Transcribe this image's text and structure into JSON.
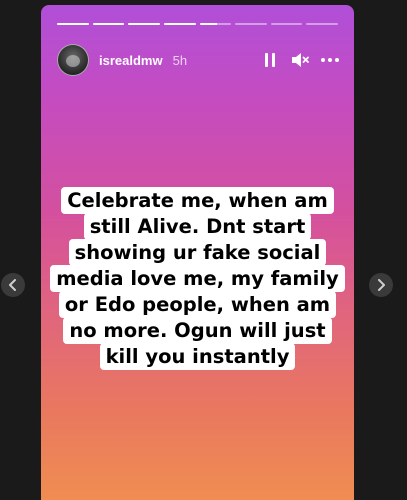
{
  "story": {
    "username": "isrealdmw",
    "time_ago": "5h",
    "progress": [
      1,
      1,
      1,
      1,
      0.55,
      0,
      0,
      0
    ],
    "caption_lines": [
      "Celebrate me, when am",
      "still Alive. Dnt start",
      "showing ur fake social",
      "media love me, my family",
      "or Edo people, when am",
      "no more. Ogun will just",
      "kill you instantly"
    ]
  },
  "controls": {
    "icons": [
      "pause-icon",
      "mute-icon",
      "more-icon"
    ]
  },
  "navigation": {
    "icons": [
      "chevron-left-icon",
      "chevron-right-icon"
    ]
  },
  "colors": {
    "gradient_top": "#b04fd8",
    "gradient_mid": "#d4509e",
    "gradient_bottom": "#f08d52",
    "page_background": "#1a1a1a"
  }
}
